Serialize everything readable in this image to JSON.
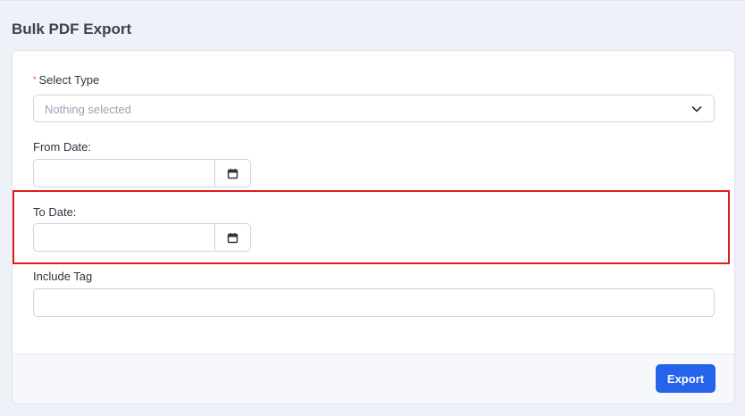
{
  "page": {
    "title": "Bulk PDF Export"
  },
  "form": {
    "select_type": {
      "label": "Select Type",
      "required_marker": "*",
      "value": "Nothing selected"
    },
    "from_date": {
      "label": "From Date:",
      "value": ""
    },
    "to_date": {
      "label": "To Date:",
      "value": ""
    },
    "include_tag": {
      "label": "Include Tag",
      "value": ""
    }
  },
  "footer": {
    "export_label": "Export"
  },
  "icons": {
    "select_chevron": "chevron-down-icon",
    "date_picker": "calendar-icon"
  },
  "colors": {
    "accent": "#2563eb",
    "required": "#e0393e",
    "highlight": "#e11d1d"
  }
}
